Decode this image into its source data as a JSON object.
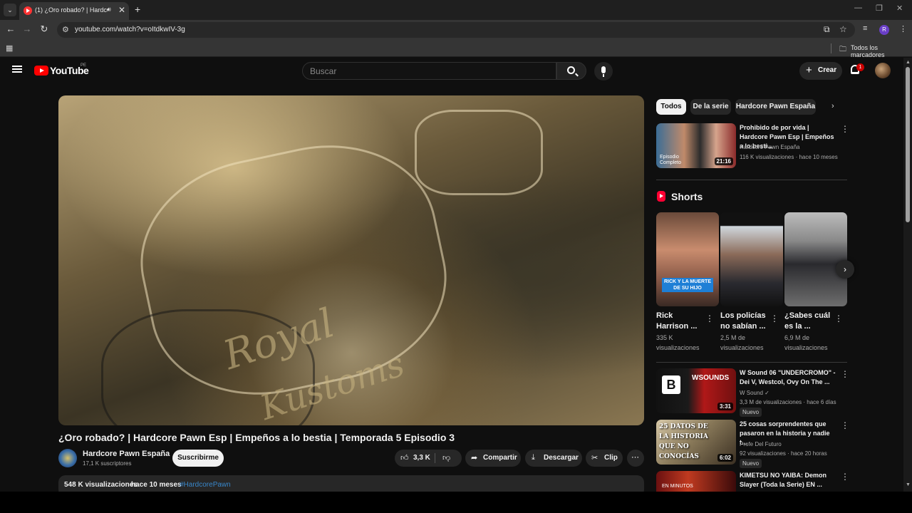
{
  "browser": {
    "tab_title": "(1) ¿Oro robado? | Hardcore Pawn Esp",
    "url": "youtube.com/watch?v=oItdkwIV-3g",
    "profile_initial": "R",
    "bookmarks_folder": "Todos los marcadores"
  },
  "masthead": {
    "logo_text": "YouTube",
    "country": "PE",
    "search_placeholder": "Buscar",
    "create_label": "Crear",
    "notification_count": "1"
  },
  "video": {
    "title": "¿Oro robado? | Hardcore Pawn Esp | Empeños a lo bestia | Temporada 5 Episodio 3",
    "overlay_text_1": "Royal",
    "overlay_text_2": "Kustoms",
    "channel_name": "Hardcore Pawn España",
    "subscribers": "17,1 K suscriptores",
    "subscribe_label": "Suscribirme",
    "likes": "3,3 K",
    "share_label": "Compartir",
    "download_label": "Descargar",
    "clip_label": "Clip",
    "views": "548 K visualizaciones",
    "date": "hace 10 meses",
    "hashtag": "#HardcorePawn"
  },
  "chips": [
    "Todos",
    "De la serie",
    "Hardcore Pawn España"
  ],
  "recommended_top": {
    "title": "Prohibido de por vida | Hardcore Pawn Esp | Empeños a lo besti...",
    "channel": "Hardcore Pawn España",
    "meta": "116 K visualizaciones · hace 10 meses",
    "duration": "21:16",
    "thumb_caption": "Episodio Completo"
  },
  "shorts": {
    "heading": "Shorts",
    "items": [
      {
        "title": "Rick Harrison ...",
        "views": "335 K visualizaciones",
        "thumb_caption": "RICK Y LA MUERTE DE SU HIJO"
      },
      {
        "title": "Los policías no sabían ...",
        "views": "2,5 M de visualizaciones"
      },
      {
        "title": "¿Sabes cuál es la ...",
        "views": "6,9 M de visualizaciones"
      }
    ]
  },
  "recommended": [
    {
      "title": "W Sound 06 \"UNDERCROMO\" - Dei V, Westcol, Ovy On The ...",
      "channel": "W Sound ✓",
      "meta": "3,3 M de visualizaciones · hace 6 días",
      "duration": "3:31",
      "badge": "Nuevo",
      "thumb_caption": "WSOUNDS"
    },
    {
      "title": "25 cosas sorprendentes que pasaron en la historia y nadie t...",
      "channel": "Profe Del Futuro",
      "meta": "92 visualizaciones · hace 20 horas",
      "duration": "6:02",
      "badge": "Nuevo",
      "thumb_caption": "25 DATOS DE LA HISTORIA QUE NO CONOCÍAS"
    },
    {
      "title": "KIMETSU NO YAIBA: Demon Slayer (Toda la Serie) EN ...",
      "thumb_caption": "EN MINUTOS"
    }
  ],
  "colors": {
    "accent": "#ff0000",
    "background": "#0f0f0f",
    "link": "#3ea6ff"
  }
}
